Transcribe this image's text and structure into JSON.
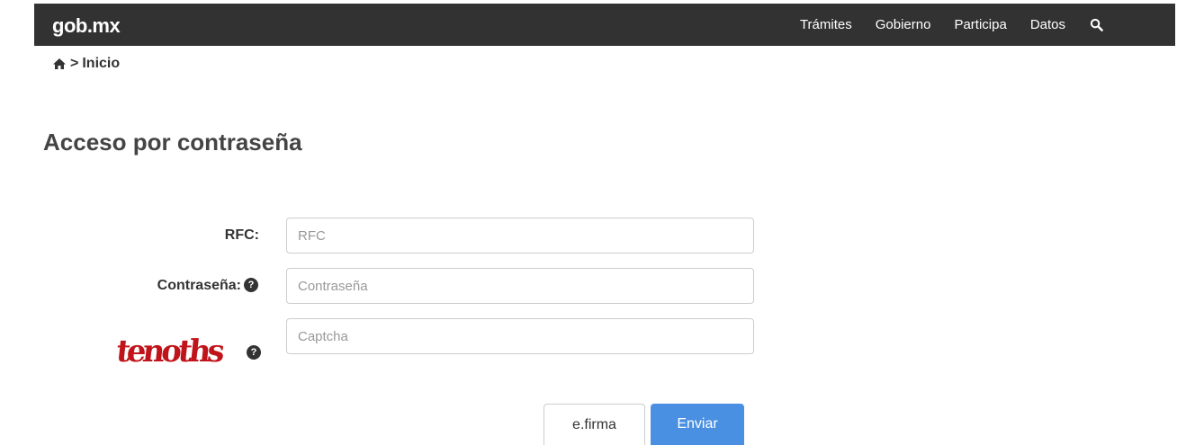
{
  "header": {
    "logo": "gob.mx",
    "nav": [
      "Trámites",
      "Gobierno",
      "Participa",
      "Datos"
    ],
    "search_icon": "search-icon"
  },
  "breadcrumb": {
    "home_icon": "home-icon",
    "separator": ">",
    "current": "Inicio"
  },
  "page": {
    "title": "Acceso por contraseña"
  },
  "form": {
    "rfc_label": "RFC:",
    "rfc_placeholder": "RFC",
    "rfc_value": "",
    "password_label": "Contraseña:",
    "password_placeholder": "Contraseña",
    "password_value": "",
    "captcha_text": "tenoths",
    "captcha_placeholder": "Captcha",
    "captcha_value": "",
    "help_icon_glyph": "?"
  },
  "buttons": {
    "efirma": "e.firma",
    "enviar": "Enviar"
  },
  "colors": {
    "header_bg": "#323232",
    "primary": "#4a90e2",
    "captcha_red": "#c0141a"
  }
}
